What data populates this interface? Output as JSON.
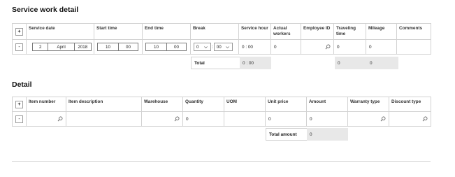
{
  "service_section": {
    "title": "Service work detail",
    "headers": {
      "service_date": "Service date",
      "start_time": "Start time",
      "end_time": "End time",
      "break": "Break",
      "service_hour": "Service hour",
      "actual_workers": "Actual workers",
      "employee_id": "Employee ID",
      "traveling_time": "Traveling time",
      "mileage": "Mileage",
      "comments": "Comments"
    },
    "add_button": "+",
    "remove_button": "-",
    "row": {
      "date_day": "2",
      "date_month": "April",
      "date_year": "2018",
      "start_hour": "10",
      "start_min": "00",
      "end_hour": "10",
      "end_min": "00",
      "break_hour": "0",
      "break_sep": ":",
      "break_min": "00",
      "service_hour": "0 : 00",
      "actual_workers": "0",
      "employee_id": "",
      "traveling_time": "0",
      "mileage": "0",
      "comments": ""
    },
    "totals": {
      "label": "Total",
      "service_hour": "0 : 00",
      "traveling_time": "0",
      "mileage": "0"
    }
  },
  "detail_section": {
    "title": "Detail",
    "headers": {
      "item_number": "Item number",
      "item_description": "Item description",
      "warehouse": "Warehouse",
      "quantity": "Quantity",
      "uom": "UOM",
      "unit_price": "Unit price",
      "amount": "Amount",
      "warranty_type": "Warranty type",
      "discount_type": "Discount type"
    },
    "add_button": "+",
    "remove_button": "-",
    "row": {
      "item_number": "",
      "item_description": "",
      "warehouse": "",
      "quantity": "0",
      "uom": "",
      "unit_price": "0",
      "amount": "0",
      "warranty_type": "",
      "discount_type": ""
    },
    "totals": {
      "label": "Total amount",
      "amount": "0"
    }
  }
}
